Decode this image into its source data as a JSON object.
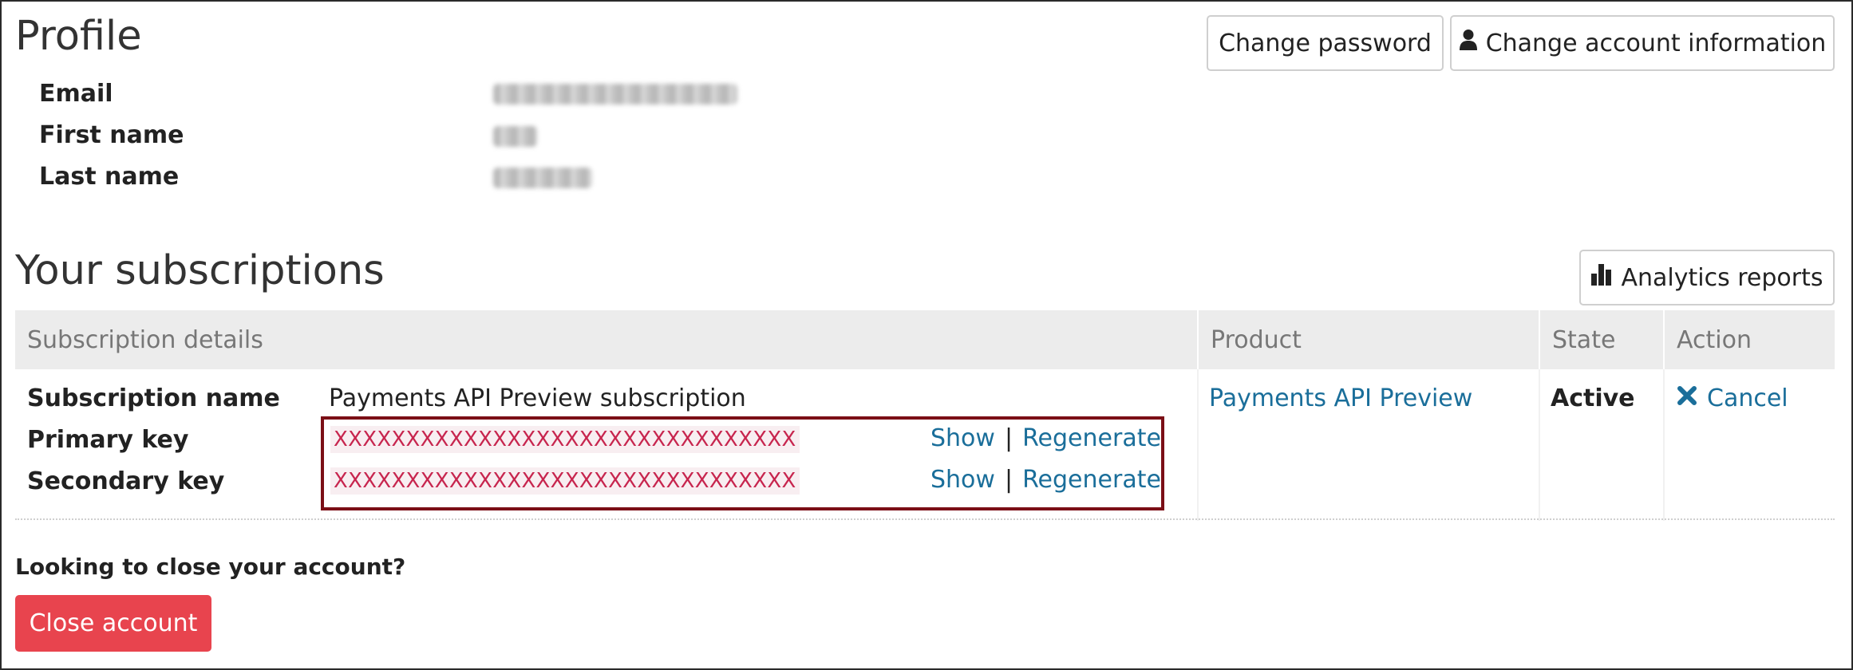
{
  "profile": {
    "title": "Profile",
    "change_password_label": "Change password",
    "change_account_label": "Change account information",
    "fields": [
      {
        "label": "Email"
      },
      {
        "label": "First name"
      },
      {
        "label": "Last name"
      }
    ]
  },
  "subscriptions": {
    "title": "Your subscriptions",
    "analytics_label": "Analytics reports",
    "columns": [
      "Subscription details",
      "Product",
      "State",
      "Action"
    ],
    "row": {
      "name_label": "Subscription name",
      "name_value": "Payments API Preview subscription",
      "primary_label": "Primary key",
      "primary_value": "XXXXXXXXXXXXXXXXXXXXXXXXXXXXXXXX",
      "secondary_label": "Secondary key",
      "secondary_value": "XXXXXXXXXXXXXXXXXXXXXXXXXXXXXXXX",
      "show_label": "Show",
      "separator": "|",
      "regenerate_label": "Regenerate",
      "product": "Payments API Preview",
      "state": "Active",
      "action_label": "Cancel"
    }
  },
  "close_account": {
    "question": "Looking to close your account?",
    "button_label": "Close account"
  },
  "colors": {
    "link": "#1a6e9a",
    "key_text": "#c7254e",
    "highlight_border": "#7b0f16",
    "danger_button": "#e8444e",
    "table_header_bg": "#ececec"
  },
  "icons": {
    "account_button": "user-icon",
    "analytics_button": "bar-chart-icon",
    "cancel_action": "close-x-icon"
  }
}
